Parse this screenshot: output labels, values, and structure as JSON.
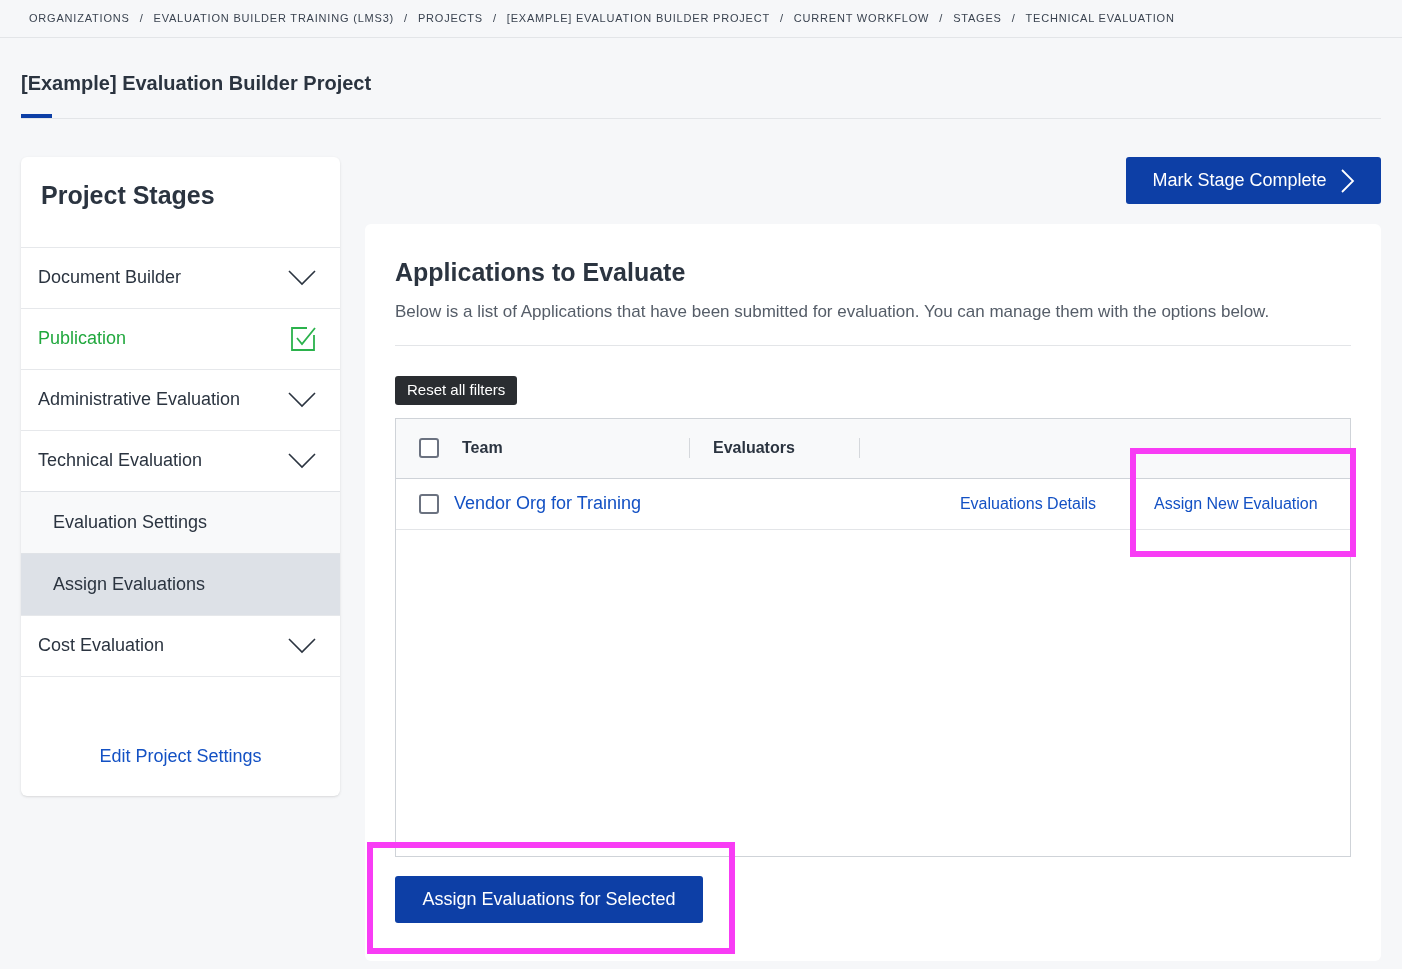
{
  "breadcrumb": [
    "ORGANIZATIONS",
    "EVALUATION BUILDER TRAINING (LMS3)",
    "PROJECTS",
    "[EXAMPLE] EVALUATION BUILDER PROJECT",
    "CURRENT WORKFLOW",
    "STAGES",
    "TECHNICAL EVALUATION"
  ],
  "breadcrumb_separator": "/",
  "page_title": "[Example] Evaluation Builder Project",
  "sidebar": {
    "title": "Project Stages",
    "stages": [
      {
        "label": "Document Builder",
        "complete": false
      },
      {
        "label": "Publication",
        "complete": true
      },
      {
        "label": "Administrative Evaluation",
        "complete": false
      },
      {
        "label": "Technical Evaluation",
        "complete": false,
        "children": [
          {
            "label": "Evaluation Settings",
            "selected": false
          },
          {
            "label": "Assign Evaluations",
            "selected": true
          }
        ]
      },
      {
        "label": "Cost Evaluation",
        "complete": false
      }
    ],
    "link": "Edit Project Settings"
  },
  "mark_complete_button": "Mark Stage Complete",
  "card": {
    "title": "Applications to Evaluate",
    "description": "Below is a list of Applications that have been submitted for evaluation. You can manage them with the options below.",
    "reset_button": "Reset all filters",
    "table": {
      "select_all_checked": false,
      "columns": [
        "Team",
        "Evaluators"
      ],
      "rows": [
        {
          "checked": false,
          "team": "Vendor Org for Training",
          "actions": [
            {
              "label": "Evaluations Details",
              "highlighted": false
            },
            {
              "label": "Assign New Evaluation",
              "highlighted": true
            }
          ]
        }
      ]
    },
    "bottom_button": {
      "label": "Assign Evaluations for Selected",
      "highlighted": true
    }
  }
}
